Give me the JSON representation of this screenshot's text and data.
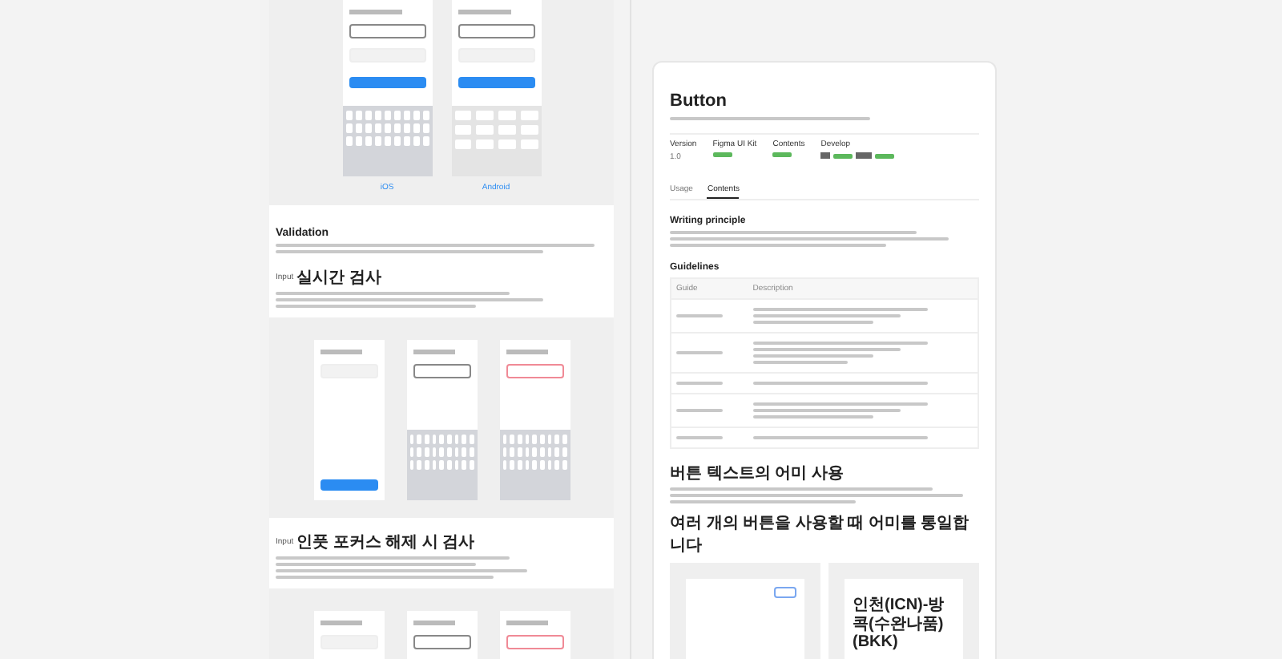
{
  "input_demo": {
    "captions": [
      "iOS",
      "Android"
    ]
  },
  "validation": {
    "title": "Validation",
    "checks": [
      {
        "tag": "Input",
        "title": "실시간 검사"
      },
      {
        "tag": "Input",
        "title": "인풋 포커스 해제 시 검사"
      }
    ]
  },
  "doc": {
    "title": "Button",
    "meta": [
      {
        "label": "Version",
        "kind": "text",
        "value": "1.0"
      },
      {
        "label": "Figma UI Kit",
        "kind": "status"
      },
      {
        "label": "Contents",
        "kind": "status"
      },
      {
        "label": "Develop",
        "kind": "platforms"
      }
    ],
    "tabs": [
      {
        "label": "Usage",
        "selected": false
      },
      {
        "label": "Contents",
        "selected": true
      }
    ],
    "writing_title": "Writing principle",
    "guidelines": {
      "title": "Guidelines",
      "columns": [
        "Guide",
        "Description"
      ]
    },
    "ending_title": "버튼 텍스트의 어미 사용",
    "unify_title": "여러 개의 버튼을 사용할 때 어미를 통일합니다",
    "route": "인천(ICN)-방콕(수완나품) (BKK)"
  }
}
